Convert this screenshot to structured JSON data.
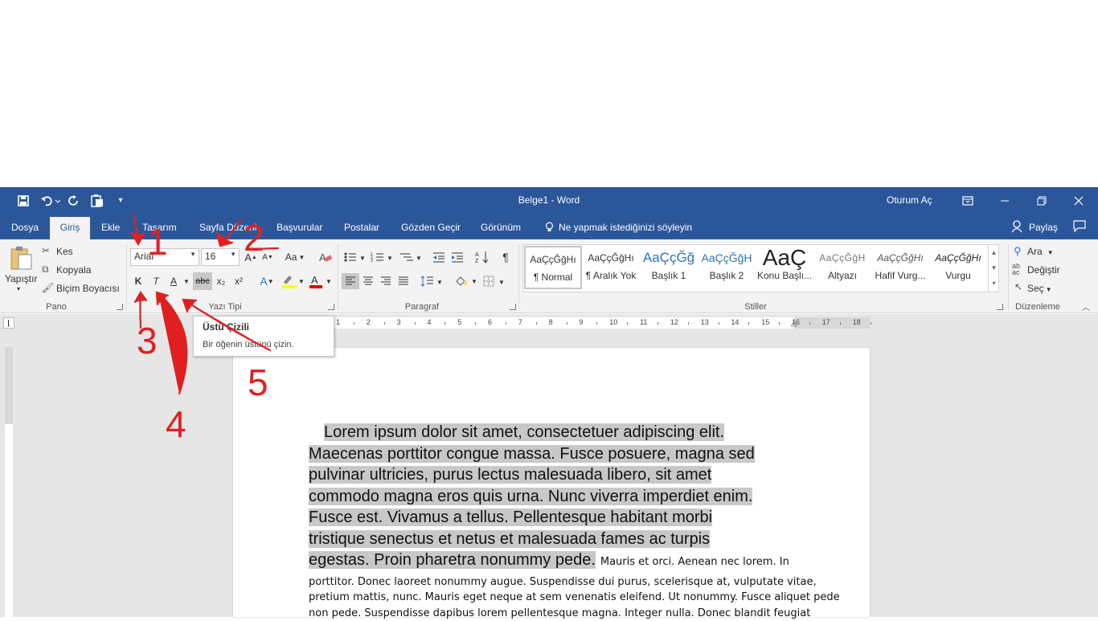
{
  "window": {
    "title": "Belge1  -  Word",
    "signin": "Oturum Aç"
  },
  "tabs": [
    "Dosya",
    "Giriş",
    "Ekle",
    "Tasarım",
    "Sayfa Düzeni",
    "Başvurular",
    "Postalar",
    "Gözden Geçir",
    "Görünüm"
  ],
  "tellme": "Ne yapmak istediğinizi söyleyin",
  "share": "Paylaş",
  "clipboard": {
    "paste": "Yapıştır",
    "cut": "Kes",
    "copy": "Kopyala",
    "format_painter": "Biçim Boyacısı",
    "label": "Pano"
  },
  "font": {
    "name": "Arial",
    "size": "16",
    "label": "Yazı Tipi",
    "case": "Aa",
    "bold": "K",
    "italic": "T",
    "underline": "A",
    "strike": "abc",
    "sub": "x₂",
    "sup": "x²"
  },
  "paragraph": {
    "label": "Paragraf"
  },
  "styles": {
    "label": "Stiller",
    "items": [
      {
        "preview": "AaÇçĞğHı",
        "name": "¶ Normal"
      },
      {
        "preview": "AaÇçĞğHı",
        "name": "¶ Aralık Yok"
      },
      {
        "preview": "AaÇçĞğ",
        "name": "Başlık 1"
      },
      {
        "preview": "AaÇçĞğH",
        "name": "Başlık 2"
      },
      {
        "preview": "AaÇ",
        "name": "Konu Başlı..."
      },
      {
        "preview": "AaÇçĞğH",
        "name": "Altyazı"
      },
      {
        "preview": "AaÇçĞğHı",
        "name": "Hafif Vurg..."
      },
      {
        "preview": "AaÇçĞğHı",
        "name": "Vurgu"
      }
    ]
  },
  "editing": {
    "find": "Ara",
    "replace": "Değiştir",
    "select": "Seç",
    "label": "Düzenleme"
  },
  "tooltip": {
    "title": "Üstü Çizili",
    "desc": "Bir öğenin üstünü çizin."
  },
  "ruler": {
    "ticks": [
      "1",
      "2",
      "3",
      "4",
      "5",
      "6",
      "7",
      "8",
      "9",
      "10",
      "11",
      "12",
      "13",
      "14",
      "15",
      "16",
      "17",
      "18"
    ]
  },
  "document": {
    "highlighted": [
      "Lorem ipsum dolor sit amet, consectetuer adipiscing elit.",
      "Maecenas porttitor congue massa. Fusce posuere, magna sed",
      "pulvinar ultricies, purus lectus malesuada libero, sit amet",
      "commodo magna eros quis urna. Nunc viverra imperdiet enim.",
      "Fusce est. Vivamus a tellus. Pellentesque habitant morbi",
      "tristique senectus et netus et malesuada fames ac turpis",
      "egestas. Proin pharetra nonummy pede."
    ],
    "tail_inline": "Mauris et orci. Aenean nec lorem. In",
    "small_lines": [
      "porttitor. Donec laoreet nonummy augue. Suspendisse dui purus, scelerisque at, vulputate vitae,",
      "pretium mattis, nunc. Mauris eget neque at sem venenatis eleifend. Ut nonummy. Fusce aliquet pede",
      "non pede. Suspendisse dapibus lorem pellentesque magna. Integer nulla. Donec blandit feugiat"
    ]
  },
  "annotations": {
    "n1": "1",
    "n2": "2",
    "n3": "3",
    "n4": "4",
    "n5": "5",
    "color": "#e02020"
  }
}
